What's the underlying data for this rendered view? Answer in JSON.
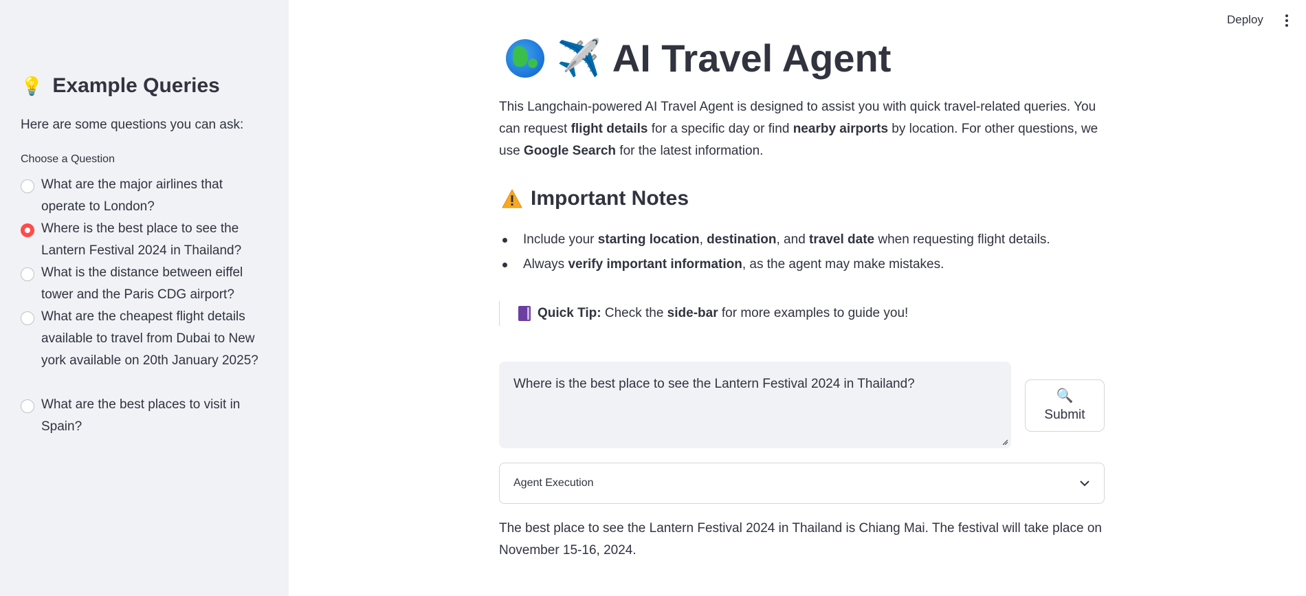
{
  "sidebar": {
    "title_emoji": "💡",
    "title": "Example Queries",
    "subtitle": "Here are some questions you can ask:",
    "radio_label": "Choose a Question",
    "questions": [
      {
        "label": "What are the major airlines that operate to London?",
        "selected": false
      },
      {
        "label": "Where is the best place to see the Lantern Festival 2024 in Thailand?",
        "selected": true
      },
      {
        "label": "What is the distance between eiffel tower and the Paris CDG airport?",
        "selected": false
      },
      {
        "label": "What are the cheapest flight details available to travel from Dubai to New york available on 20th January 2025?",
        "selected": false
      },
      {
        "label": "What are the best places to visit in Spain?",
        "selected": false
      }
    ]
  },
  "header": {
    "deploy_label": "Deploy"
  },
  "main": {
    "title": "AI Travel Agent",
    "plane_emoji": "✈️",
    "intro": {
      "p1": "This Langchain-powered AI Travel Agent is designed to assist you with quick travel-related queries. You can request ",
      "b1": "flight details",
      "p2": " for a specific day or find ",
      "b2": "nearby airports",
      "p3": " by location. For other questions, we use ",
      "b3": "Google Search",
      "p4": " for the latest information."
    },
    "notes_title": "Important Notes",
    "notes": {
      "n1_a": "Include your ",
      "n1_b1": "starting location",
      "n1_c": ", ",
      "n1_b2": "destination",
      "n1_d": ", and ",
      "n1_b3": "travel date",
      "n1_e": " when requesting flight details.",
      "n2_a": "Always ",
      "n2_b": "verify important information",
      "n2_c": ", as the agent may make mistakes."
    },
    "tip": {
      "bold": "Quick Tip:",
      "t1": " Check the ",
      "b": "side-bar",
      "t2": " for more examples to guide you!"
    },
    "query_value": "Where is the best place to see the Lantern Festival 2024 in Thailand?",
    "submit_emoji": "🔍",
    "submit_label": "Submit",
    "expander_label": "Agent Execution",
    "answer": "The best place to see the Lantern Festival 2024 in Thailand is Chiang Mai. The festival will take place on November 15-16, 2024."
  },
  "colors": {
    "accent": "#ff4b4b",
    "sidebar_bg": "#f0f2f6",
    "text": "#31333f"
  }
}
